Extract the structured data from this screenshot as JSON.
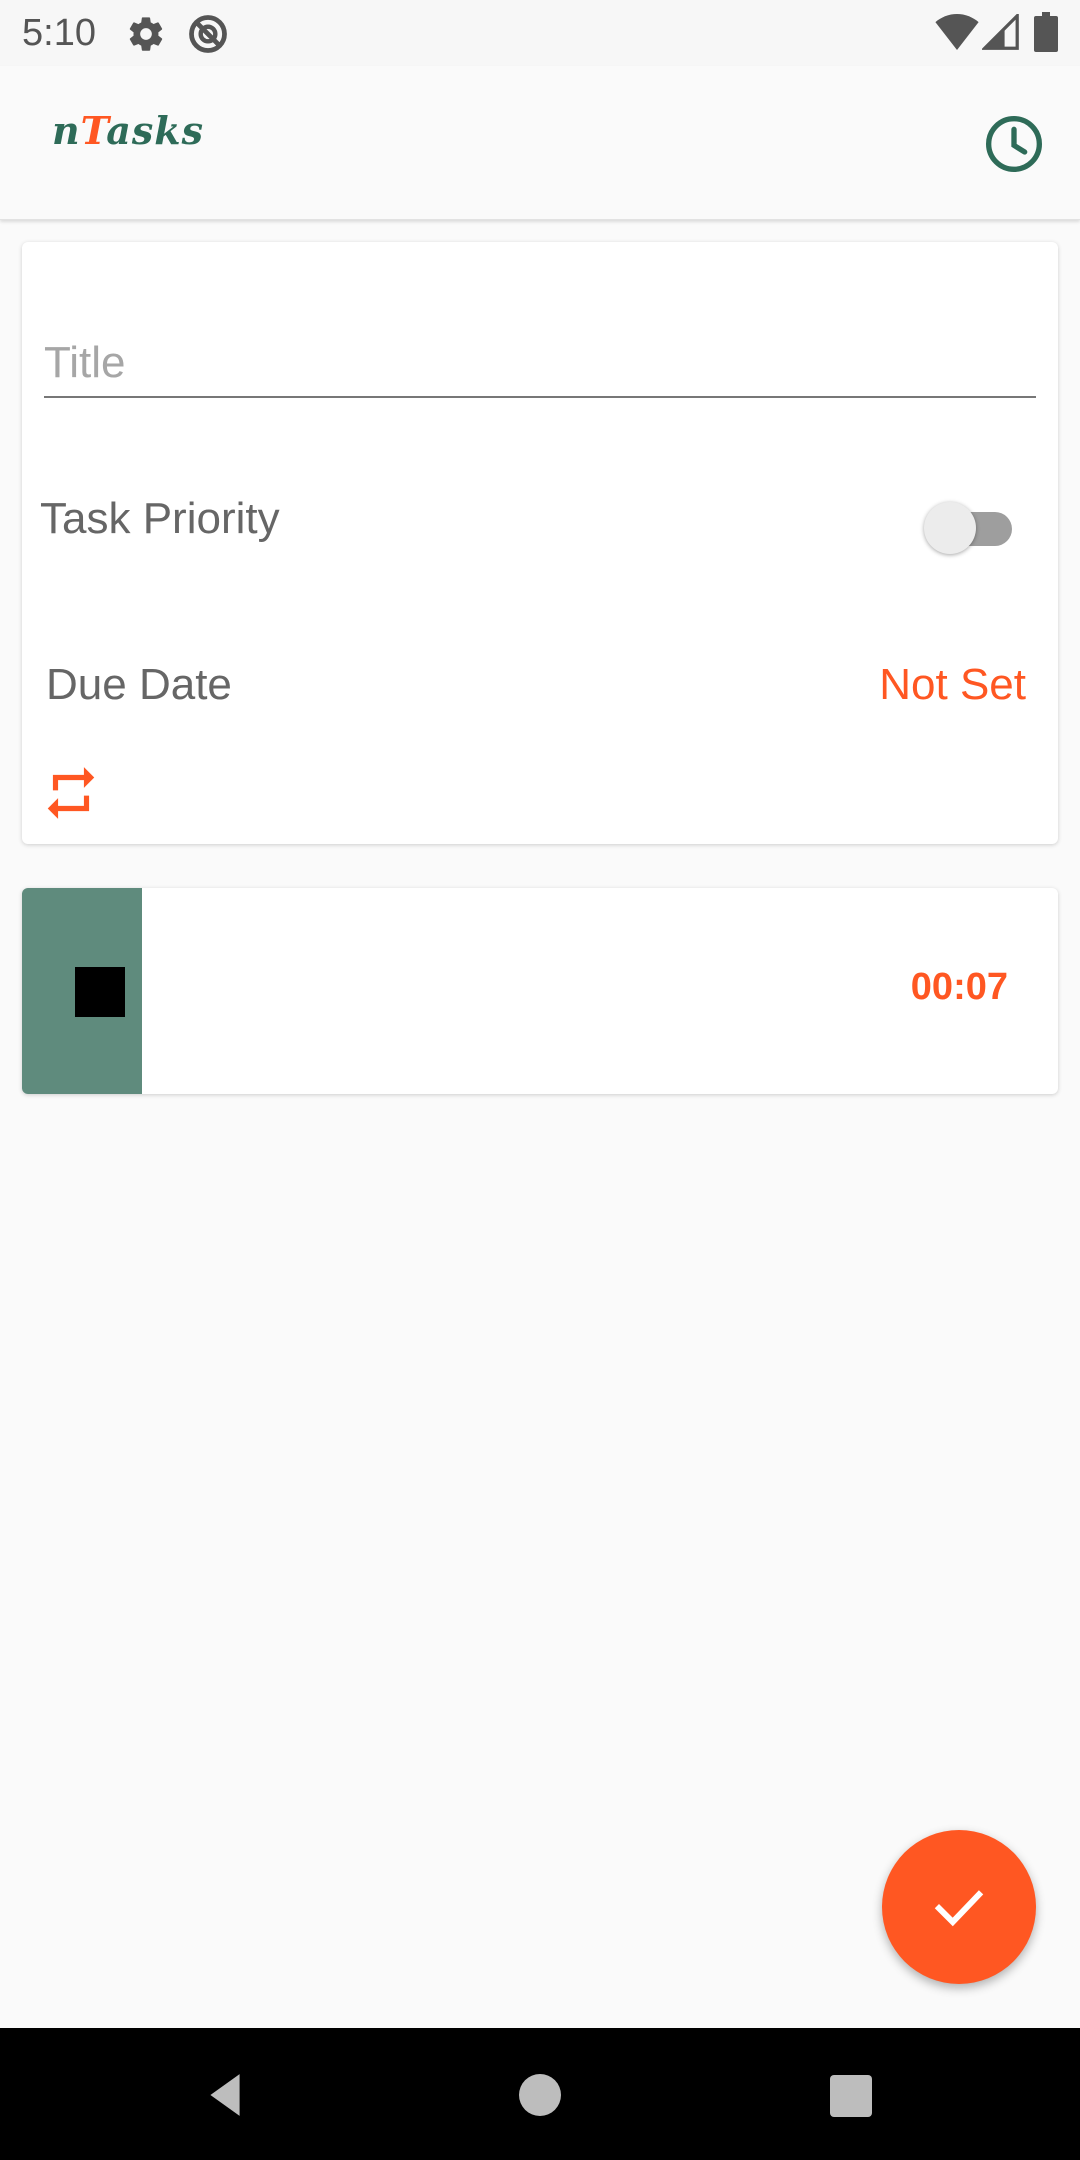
{
  "status_bar": {
    "time": "5:10",
    "icons": [
      "gear-icon",
      "sync-disabled-icon",
      "wifi-icon",
      "signal-icon",
      "battery-icon"
    ]
  },
  "app_bar": {
    "logo_prefix": "n",
    "logo_accent": "T",
    "logo_suffix": "asks",
    "clock_icon": "clock-icon"
  },
  "form": {
    "title_placeholder": "Title",
    "title_value": "",
    "priority_label": "Task Priority",
    "priority_on": false,
    "due_label": "Due Date",
    "due_value": "Not Set",
    "repeat_icon": "repeat-icon"
  },
  "timer": {
    "value": "00:07",
    "stop_icon": "stop-icon"
  },
  "fab": {
    "icon": "check-icon"
  },
  "colors": {
    "accent": "#ff5722",
    "brand_green": "#2e6b58",
    "timer_side": "#5f8b7d"
  }
}
